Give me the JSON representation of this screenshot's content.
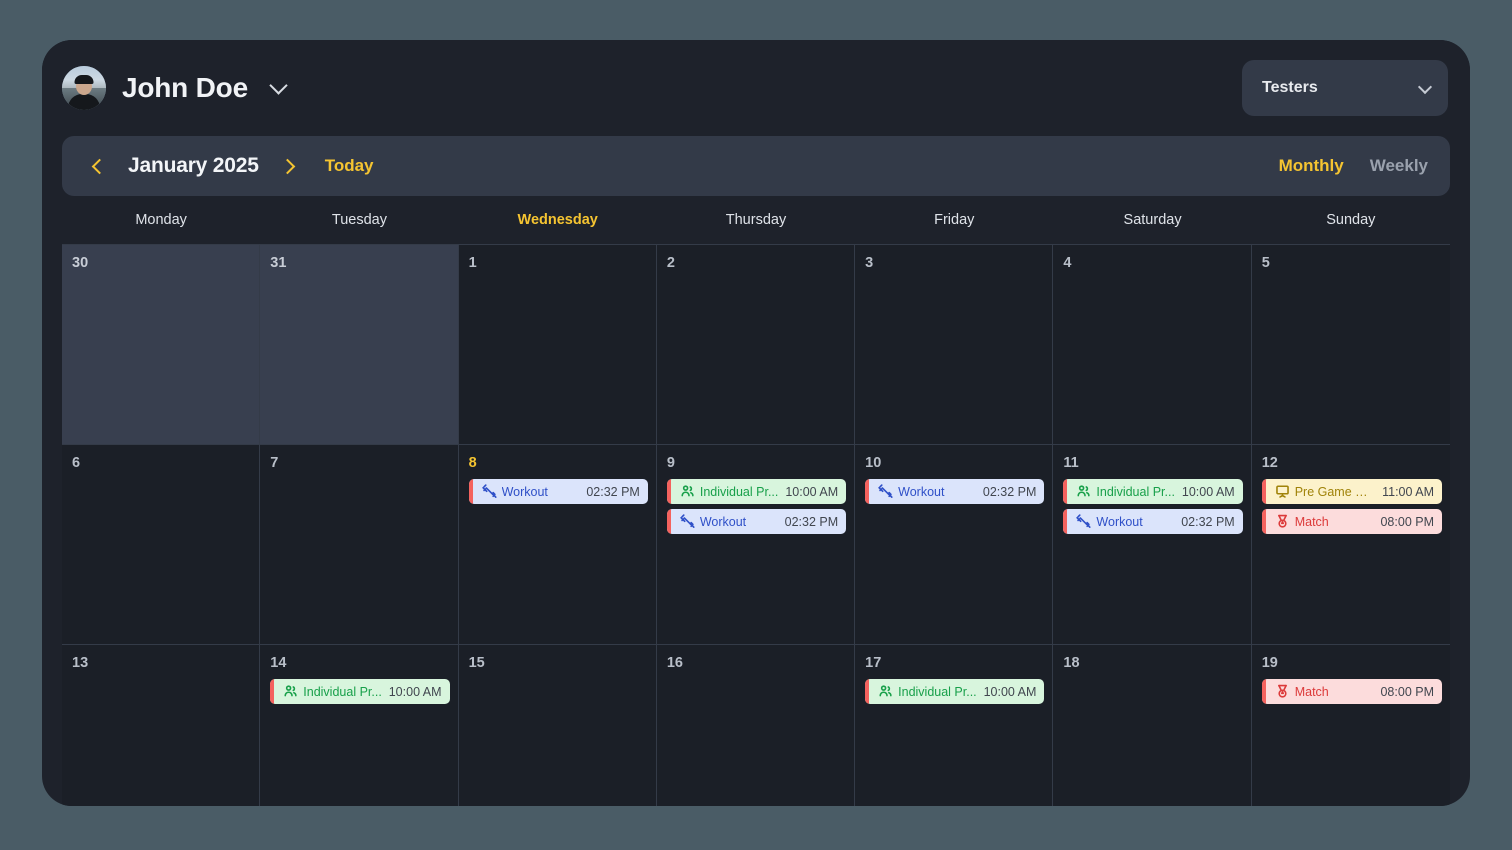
{
  "header": {
    "user_name": "John Doe",
    "profile_chevron_icon": "chevron-down-icon",
    "team_selector": {
      "value": "Testers",
      "chevron_icon": "chevron-down-icon"
    }
  },
  "toolbar": {
    "prev_icon": "chevron-left-icon",
    "next_icon": "chevron-right-icon",
    "month_label": "January 2025",
    "today_label": "Today",
    "views": [
      {
        "label": "Monthly",
        "active": true
      },
      {
        "label": "Weekly",
        "active": false
      }
    ]
  },
  "weekdays": [
    {
      "label": "Monday",
      "today": false
    },
    {
      "label": "Tuesday",
      "today": false
    },
    {
      "label": "Wednesday",
      "today": true
    },
    {
      "label": "Thursday",
      "today": false
    },
    {
      "label": "Friday",
      "today": false
    },
    {
      "label": "Saturday",
      "today": false
    },
    {
      "label": "Sunday",
      "today": false
    }
  ],
  "colors": {
    "accent_yellow": "#f5c431",
    "page_background": "#4a5c66",
    "card_background": "#1e222b",
    "cell_background": "#1b1f27",
    "other_month_cell": "#383f4f",
    "chip_accent_bar": "#f4625e",
    "workout_bg": "#dbe4fb",
    "workout_text": "#2f50c8",
    "practice_bg": "#d8f5dd",
    "practice_text": "#18a04a",
    "meeting_bg": "#fcf2cb",
    "meeting_text": "#a08309",
    "match_bg": "#fcdcdc",
    "match_text": "#dc3a3a"
  },
  "days": [
    {
      "num": "30",
      "other_month": true,
      "today": false,
      "events": []
    },
    {
      "num": "31",
      "other_month": true,
      "today": false,
      "events": []
    },
    {
      "num": "1",
      "other_month": false,
      "today": false,
      "events": []
    },
    {
      "num": "2",
      "other_month": false,
      "today": false,
      "events": []
    },
    {
      "num": "3",
      "other_month": false,
      "today": false,
      "events": []
    },
    {
      "num": "4",
      "other_month": false,
      "today": false,
      "events": []
    },
    {
      "num": "5",
      "other_month": false,
      "today": false,
      "events": []
    },
    {
      "num": "6",
      "other_month": false,
      "today": false,
      "events": []
    },
    {
      "num": "7",
      "other_month": false,
      "today": false,
      "events": []
    },
    {
      "num": "8",
      "other_month": false,
      "today": true,
      "events": [
        {
          "type": "workout",
          "icon": "dumbbell-icon",
          "title": "Workout",
          "time": "02:32 PM"
        }
      ]
    },
    {
      "num": "9",
      "other_month": false,
      "today": false,
      "events": [
        {
          "type": "practice",
          "icon": "users-icon",
          "title": "Individual Pr...",
          "time": "10:00 AM"
        },
        {
          "type": "workout",
          "icon": "dumbbell-icon",
          "title": "Workout",
          "time": "02:32 PM"
        }
      ]
    },
    {
      "num": "10",
      "other_month": false,
      "today": false,
      "events": [
        {
          "type": "workout",
          "icon": "dumbbell-icon",
          "title": "Workout",
          "time": "02:32 PM"
        }
      ]
    },
    {
      "num": "11",
      "other_month": false,
      "today": false,
      "events": [
        {
          "type": "practice",
          "icon": "users-icon",
          "title": "Individual Pr...",
          "time": "10:00 AM"
        },
        {
          "type": "workout",
          "icon": "dumbbell-icon",
          "title": "Workout",
          "time": "02:32 PM"
        }
      ]
    },
    {
      "num": "12",
      "other_month": false,
      "today": false,
      "events": [
        {
          "type": "meeting",
          "icon": "presentation-icon",
          "title": "Pre Game Me...",
          "time": "11:00 AM"
        },
        {
          "type": "match",
          "icon": "medal-icon",
          "title": "Match",
          "time": "08:00 PM"
        }
      ]
    },
    {
      "num": "13",
      "other_month": false,
      "today": false,
      "events": []
    },
    {
      "num": "14",
      "other_month": false,
      "today": false,
      "events": [
        {
          "type": "practice",
          "icon": "users-icon",
          "title": "Individual Pr...",
          "time": "10:00 AM"
        }
      ]
    },
    {
      "num": "15",
      "other_month": false,
      "today": false,
      "events": []
    },
    {
      "num": "16",
      "other_month": false,
      "today": false,
      "events": []
    },
    {
      "num": "17",
      "other_month": false,
      "today": false,
      "events": [
        {
          "type": "practice",
          "icon": "users-icon",
          "title": "Individual Pr...",
          "time": "10:00 AM"
        }
      ]
    },
    {
      "num": "18",
      "other_month": false,
      "today": false,
      "events": []
    },
    {
      "num": "19",
      "other_month": false,
      "today": false,
      "events": [
        {
          "type": "match",
          "icon": "medal-icon",
          "title": "Match",
          "time": "08:00 PM"
        }
      ]
    }
  ]
}
